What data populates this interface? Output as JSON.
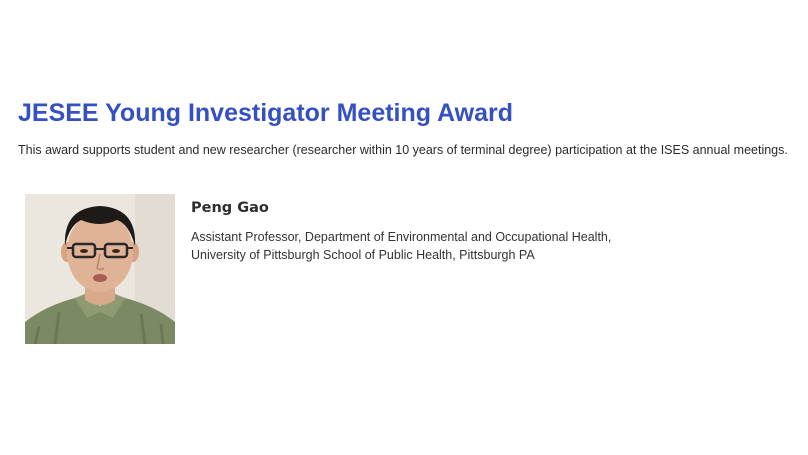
{
  "award": {
    "title": "JESEE Young Investigator Meeting Award",
    "description": "This award supports student and new researcher (researcher within 10 years of terminal degree) participation at the ISES annual meetings."
  },
  "recipient": {
    "name": "Peng Gao",
    "affiliation_line1": "Assistant Professor, Department of Environmental and Occupational Health,",
    "affiliation_line2": "University of Pittsburgh School of Public Health, Pittsburgh PA",
    "photo": "portrait-photo"
  },
  "colors": {
    "title": "#3550c0",
    "text": "#2b2b2b",
    "background": "#ffffff"
  }
}
